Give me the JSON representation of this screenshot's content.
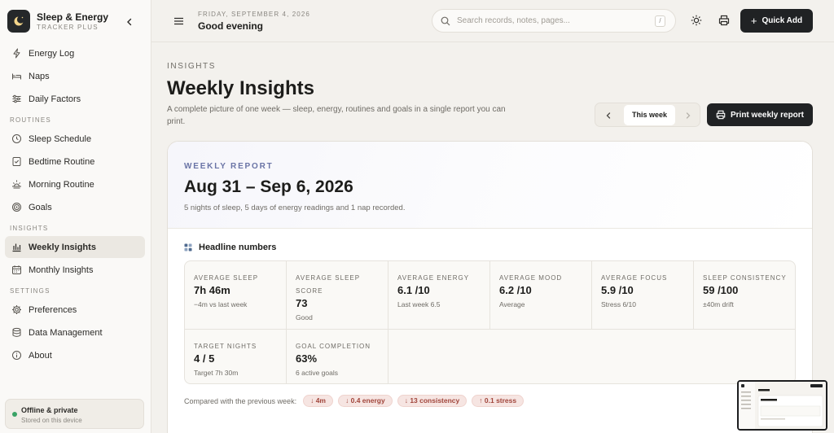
{
  "brand": {
    "title": "Sleep & Energy",
    "subtitle": "TRACKER PLUS"
  },
  "sidebar": {
    "items": [
      {
        "label": "Energy Log",
        "icon": "bolt-icon"
      },
      {
        "label": "Naps",
        "icon": "bed-icon"
      },
      {
        "label": "Daily Factors",
        "icon": "sliders-icon"
      }
    ],
    "sections": [
      {
        "title": "ROUTINES",
        "items": [
          {
            "label": "Sleep Schedule",
            "icon": "clock-icon"
          },
          {
            "label": "Bedtime Routine",
            "icon": "checklist-icon"
          },
          {
            "label": "Morning Routine",
            "icon": "sunrise-icon"
          },
          {
            "label": "Goals",
            "icon": "target-icon"
          }
        ]
      },
      {
        "title": "INSIGHTS",
        "items": [
          {
            "label": "Weekly Insights",
            "icon": "bar-chart-icon",
            "active": true
          },
          {
            "label": "Monthly Insights",
            "icon": "calendar-icon"
          }
        ]
      },
      {
        "title": "SETTINGS",
        "items": [
          {
            "label": "Preferences",
            "icon": "gear-icon"
          },
          {
            "label": "Data Management",
            "icon": "database-icon"
          },
          {
            "label": "About",
            "icon": "info-icon"
          }
        ]
      }
    ],
    "status": {
      "title": "Offline & private",
      "subtitle": "Stored on this device",
      "color": "#3aa366"
    }
  },
  "topbar": {
    "date": "FRIDAY, SEPTEMBER 4, 2026",
    "greeting": "Good evening",
    "search_placeholder": "Search records, notes, pages...",
    "search_shortcut": "/",
    "quick_add": "Quick Add"
  },
  "page": {
    "eyebrow": "INSIGHTS",
    "title": "Weekly Insights",
    "subtitle": "A complete picture of one week — sleep, energy, routines and goals in a single report you can print.",
    "week_label": "This week",
    "print_label": "Print weekly report"
  },
  "report": {
    "eyebrow": "WEEKLY REPORT",
    "range": "Aug 31 – Sep 6, 2026",
    "summary": "5 nights of sleep, 5 days of energy readings and 1 nap recorded.",
    "section_title": "Headline numbers",
    "metrics": [
      {
        "label": "AVERAGE SLEEP",
        "value": "7h 46m",
        "note": "−4m vs last week"
      },
      {
        "label": "AVERAGE SLEEP SCORE",
        "value": "73",
        "note": "Good"
      },
      {
        "label": "AVERAGE ENERGY",
        "value": "6.1 /10",
        "note": "Last week 6.5"
      },
      {
        "label": "AVERAGE MOOD",
        "value": "6.2 /10",
        "note": "Average"
      },
      {
        "label": "AVERAGE FOCUS",
        "value": "5.9 /10",
        "note": "Stress 6/10"
      },
      {
        "label": "SLEEP CONSISTENCY",
        "value": "59 /100",
        "note": "±40m drift"
      },
      {
        "label": "TARGET NIGHTS",
        "value": "4 / 5",
        "note": "Target 7h 30m"
      },
      {
        "label": "GOAL COMPLETION",
        "value": "63%",
        "note": "6 active goals"
      }
    ],
    "compare_label": "Compared with the previous week:",
    "changes": [
      {
        "dir": "↓",
        "text": "4m"
      },
      {
        "dir": "↓",
        "text": "0.4 energy"
      },
      {
        "dir": "↓",
        "text": "13 consistency"
      },
      {
        "dir": "↑",
        "text": "0.1 stress"
      }
    ]
  },
  "colors": {
    "accent_dark": "#202224",
    "eyebrow_blue": "#6a74a6",
    "decline_red": "#a1453b"
  }
}
